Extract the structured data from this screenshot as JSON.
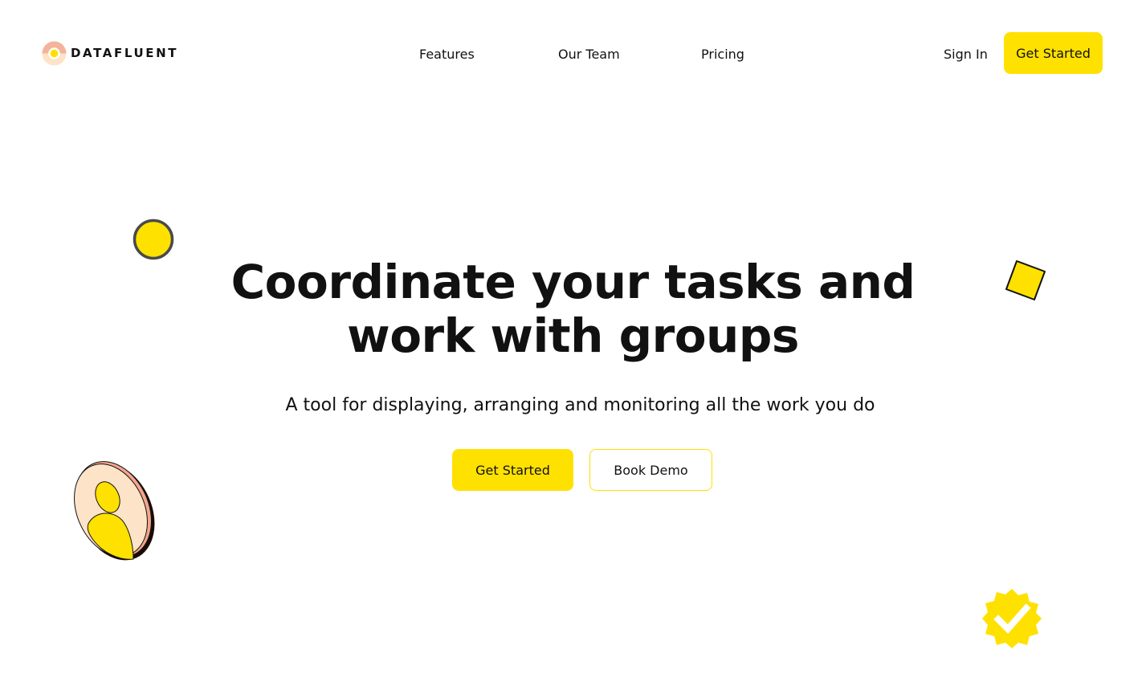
{
  "brand": {
    "name": "DATAFLUENT",
    "logo_icon": "datafluent-logo-icon"
  },
  "nav": {
    "items": [
      {
        "label": "Features"
      },
      {
        "label": "Our Team"
      },
      {
        "label": "Pricing"
      }
    ],
    "sign_in_label": "Sign In",
    "get_started_label": "Get Started"
  },
  "hero": {
    "title_line1": "Coordinate your tasks and",
    "title_line2": "work with groups",
    "subtitle": "A tool for displaying, arranging and monitoring all the work you do",
    "primary_cta_label": "Get Started",
    "secondary_cta_label": "Book Demo"
  },
  "decorations": [
    {
      "icon": "yellow-circle-icon"
    },
    {
      "icon": "yellow-square-icon"
    },
    {
      "icon": "user-coin-icon"
    },
    {
      "icon": "verified-badge-icon"
    }
  ],
  "colors": {
    "accent": "#FFE100",
    "text": "#111111",
    "background": "#FFFFFF",
    "logo_peach": "#F4B49A",
    "logo_light": "#FDE3C8"
  }
}
